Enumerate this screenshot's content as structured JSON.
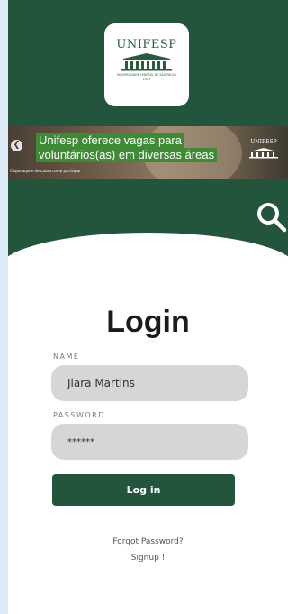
{
  "logo": {
    "name": "UNIFESP",
    "subtitle": "UNIVERSIDADE FEDERAL DE SÃO PAULO",
    "year": "1933"
  },
  "banner": {
    "line1": "Unifesp oferece vagas para",
    "line2": "voluntários(as) em diversas áreas",
    "caption": "Clique aqui e descubra como participar",
    "brand": "UNIFESP",
    "arrow": "❮"
  },
  "search": {
    "icon": "search-icon"
  },
  "login": {
    "title": "Login",
    "name_label": "NAME",
    "name_value": "Jiara Martins",
    "password_label": "PASSWORD",
    "password_value": "******",
    "button": "Log in",
    "forgot": "Forgot Password?",
    "signup": "Signup !"
  },
  "colors": {
    "primary": "#22553b",
    "input_bg": "#d6d6d6",
    "page_bg": "#dce9f7"
  }
}
